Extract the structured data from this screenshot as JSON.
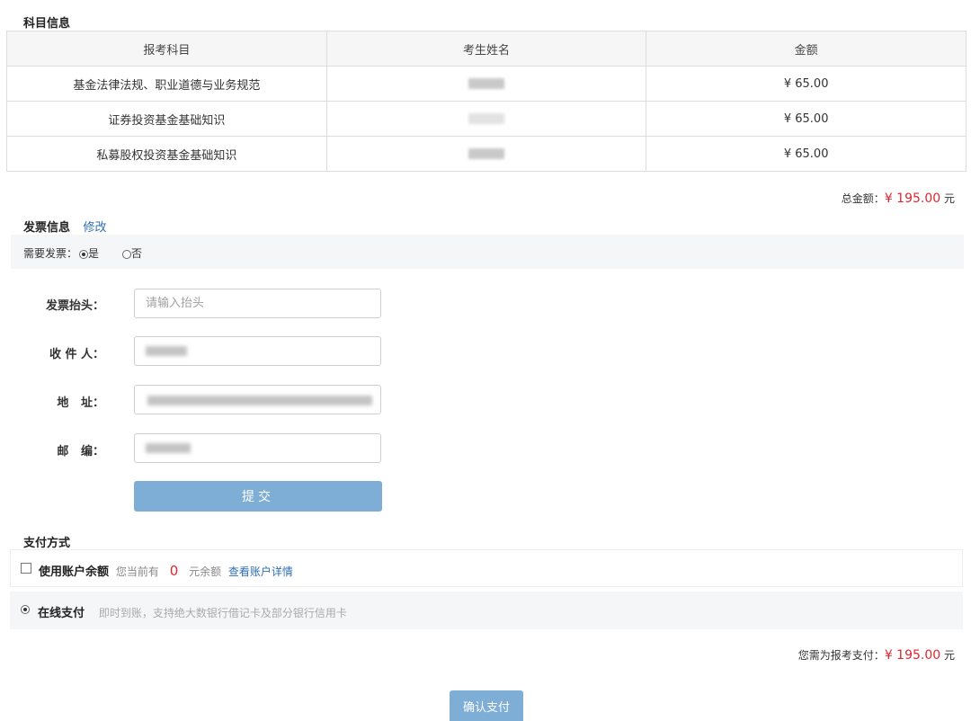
{
  "subjects_section": {
    "title": "科目信息",
    "headers": [
      "报考科目",
      "考生姓名",
      "金额"
    ],
    "rows": [
      {
        "subject": "基金法律法规、职业道德与业务规范",
        "amount": "¥ 65.00"
      },
      {
        "subject": "证券投资基金基础知识",
        "amount": "¥ 65.00"
      },
      {
        "subject": "私募股权投资基金基础知识",
        "amount": "¥ 65.00"
      }
    ],
    "total_label": "总金额：",
    "total_value": "¥ 195.00",
    "total_unit": "元"
  },
  "invoice_section": {
    "title": "发票信息",
    "edit_link": "修改",
    "need_label": "需要发票：",
    "option_yes": "是",
    "option_no": "否",
    "selected": "是",
    "fields": {
      "title_label": "发票抬头：",
      "title_placeholder": "请输入抬头",
      "receiver_label": "收 件 人：",
      "address_label": "地   址：",
      "postcode_label": "邮   编："
    },
    "submit_label": "提交"
  },
  "payment_section": {
    "title": "支付方式",
    "balance_option": {
      "label": "使用账户余额",
      "prefix": "您当前有",
      "amount": "0",
      "suffix": "元余额",
      "details_link": "查看账户详情",
      "checked": false
    },
    "online_option": {
      "label": "在线支付",
      "description": "即时到账，支持绝大数银行借记卡及部分银行信用卡",
      "selected": true
    },
    "need_pay_label": "您需为报考支付：",
    "need_pay_value": "¥ 195.00",
    "need_pay_unit": "元",
    "confirm_label": "确认支付"
  },
  "colors": {
    "accent_red": "#e0262e",
    "link_blue": "#2f6fb1",
    "button_blue": "#7eaed6"
  }
}
